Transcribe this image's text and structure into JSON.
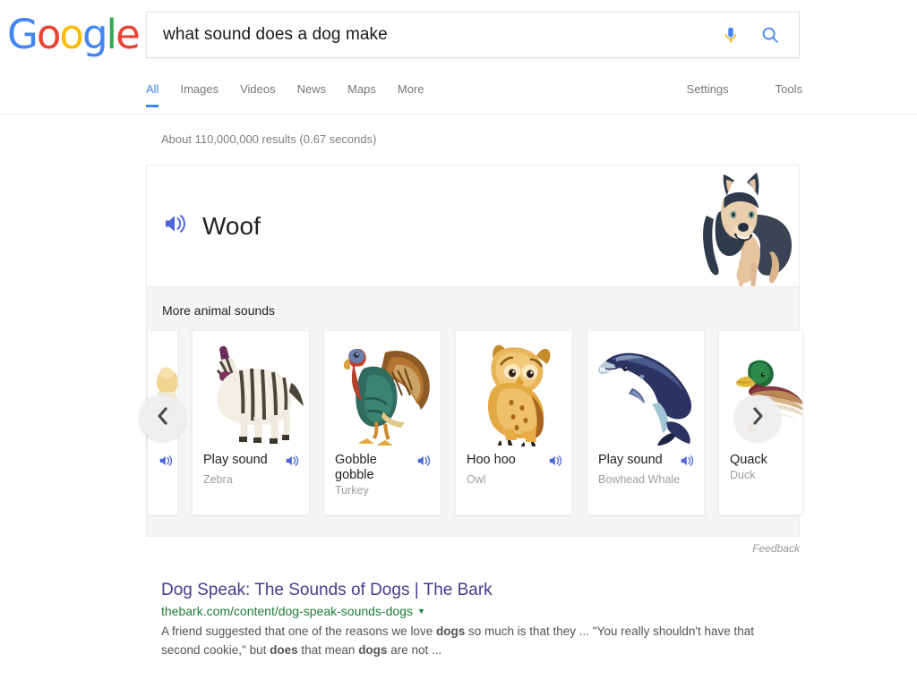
{
  "brand": {
    "logo_letters": [
      {
        "char": "G",
        "color": "#4285f4"
      },
      {
        "char": "o",
        "color": "#ea4335"
      },
      {
        "char": "o",
        "color": "#fbbc05"
      },
      {
        "char": "g",
        "color": "#4285f4"
      },
      {
        "char": "l",
        "color": "#34a853"
      },
      {
        "char": "e",
        "color": "#ea4335"
      }
    ]
  },
  "search": {
    "query": "what sound does a dog make",
    "placeholder": "Search",
    "mic_icon": "microphone-icon",
    "search_icon": "search-icon"
  },
  "nav": {
    "tabs": [
      {
        "label": "All",
        "active": true
      },
      {
        "label": "Images",
        "active": false
      },
      {
        "label": "Videos",
        "active": false
      },
      {
        "label": "News",
        "active": false
      },
      {
        "label": "Maps",
        "active": false
      },
      {
        "label": "More",
        "active": false
      }
    ],
    "tools": [
      {
        "label": "Settings"
      },
      {
        "label": "Tools"
      }
    ]
  },
  "result_stats": "About 110,000,000 results (0.67 seconds)",
  "answer": {
    "sound_text": "Woof",
    "speaker_icon": "speaker-icon",
    "hero_animal": "dog-husky-illustration",
    "carousel_title": "More animal sounds",
    "prev_icon": "chevron-left-icon",
    "next_icon": "chevron-right-icon",
    "cards": [
      {
        "label": "",
        "sub": "",
        "animal": "partial-card-left",
        "partial": "left"
      },
      {
        "label": "Play sound",
        "sub": "Zebra",
        "animal": "zebra"
      },
      {
        "label": "Gobble gobble",
        "sub": "Turkey",
        "animal": "turkey"
      },
      {
        "label": "Hoo hoo",
        "sub": "Owl",
        "animal": "owl"
      },
      {
        "label": "Play sound",
        "sub": "Bowhead Whale",
        "animal": "whale"
      },
      {
        "label": "Quack",
        "sub": "Duck",
        "animal": "duck",
        "partial": "right"
      }
    ],
    "feedback_label": "Feedback"
  },
  "organic_results": [
    {
      "title": "Dog Speak: The Sounds of Dogs | The Bark",
      "url": "thebark.com/content/dog-speak-sounds-dogs",
      "snippet_parts": [
        {
          "text": "A friend suggested that one of the reasons we love ",
          "bold": false
        },
        {
          "text": "dogs",
          "bold": true
        },
        {
          "text": " so much is that they ... \"You really shouldn't have that second cookie,\" but ",
          "bold": false
        },
        {
          "text": "does",
          "bold": true
        },
        {
          "text": " that mean ",
          "bold": false
        },
        {
          "text": "dogs",
          "bold": true
        },
        {
          "text": " are not ...",
          "bold": false
        }
      ]
    }
  ],
  "colors": {
    "google_blue": "#4285f4",
    "link_visited": "#4b3a8f",
    "url_green": "#1e7d38",
    "speaker_blue": "#4a66d8"
  }
}
